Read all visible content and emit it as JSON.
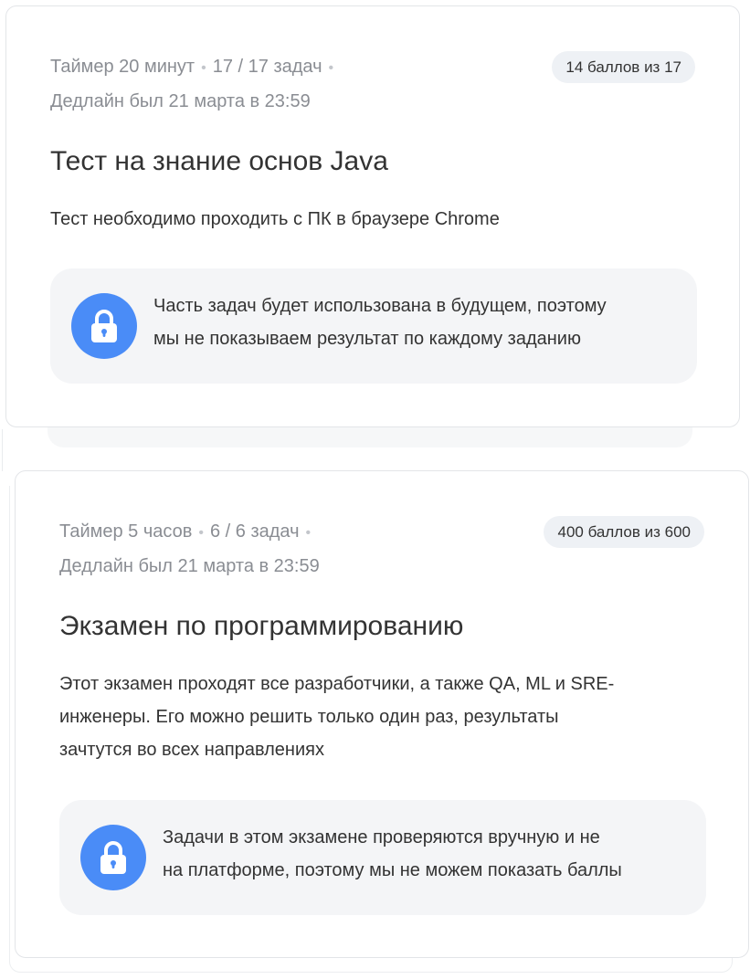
{
  "cards": [
    {
      "timer": "Таймер 20 минут",
      "tasks": "17 / 17 задач",
      "deadline": "Дедлайн был 21 марта в 23:59",
      "score": "14 баллов из 17",
      "title": "Тест на знание основ Java",
      "description": "Тест необходимо проходить с ПК в браузере Chrome",
      "notice_line1": "Часть задач будет использована в будущем, поэтому",
      "notice_line2": "мы не показываем результат по каждому заданию",
      "notice_icon": "lock-icon"
    },
    {
      "timer": "Таймер 5 часов",
      "tasks": "6 / 6 задач",
      "deadline": "Дедлайн был 21 марта в 23:59",
      "score": "400 баллов из 600",
      "title": "Экзамен по программированию",
      "description_line1": "Этот экзамен проходят все разработчики, а также QA, ML и SRE-",
      "description_line2": "инженеры. Его можно решить только один раз, результаты",
      "description_line3": "зачтутся во всех направлениях",
      "notice_line1": "Задачи в этом экзамене проверяются вручную и не",
      "notice_line2": "на платформе, поэтому мы не можем показать баллы",
      "notice_icon": "lock-icon"
    }
  ],
  "colors": {
    "accent_blue": "#4a8cf7",
    "badge_bg": "#eef1f5",
    "notice_bg": "#f4f5f7",
    "meta_text": "#8a8d93"
  }
}
